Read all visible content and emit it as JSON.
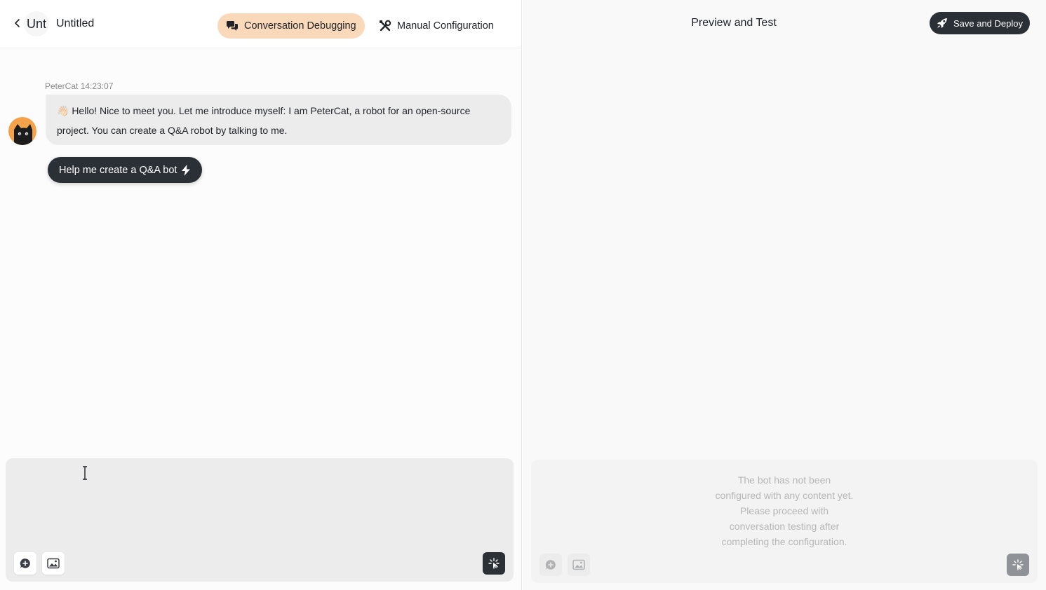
{
  "header": {
    "avatar_text": "Unt",
    "bot_name": "Untitled",
    "tabs": [
      {
        "label": "Conversation Debugging",
        "icon": "chat-bubbles-icon",
        "active": true
      },
      {
        "label": "Manual Configuration",
        "icon": "tools-icon",
        "active": false
      }
    ]
  },
  "chat": {
    "sender": "PeterCat",
    "time": "14:23:07",
    "meta": "PeterCat 14:23:07",
    "message": "👋🏻 Hello! Nice to meet you. Let me introduce myself: I am PeterCat, a robot for an open-source project. You can create a Q&A robot by talking to me.",
    "quick_action": "Help me create a Q&A bot"
  },
  "composer": {
    "value": "",
    "placeholder": ""
  },
  "preview": {
    "title": "Preview and Test",
    "deploy_label": "Save and Deploy",
    "empty_text": "The bot has not been configured with any content yet. Please proceed with conversation testing after completing the configuration."
  },
  "colors": {
    "active_tab": "#fad9bb",
    "dark_button": "#2b2f36",
    "bubble_bg": "#ececec"
  }
}
